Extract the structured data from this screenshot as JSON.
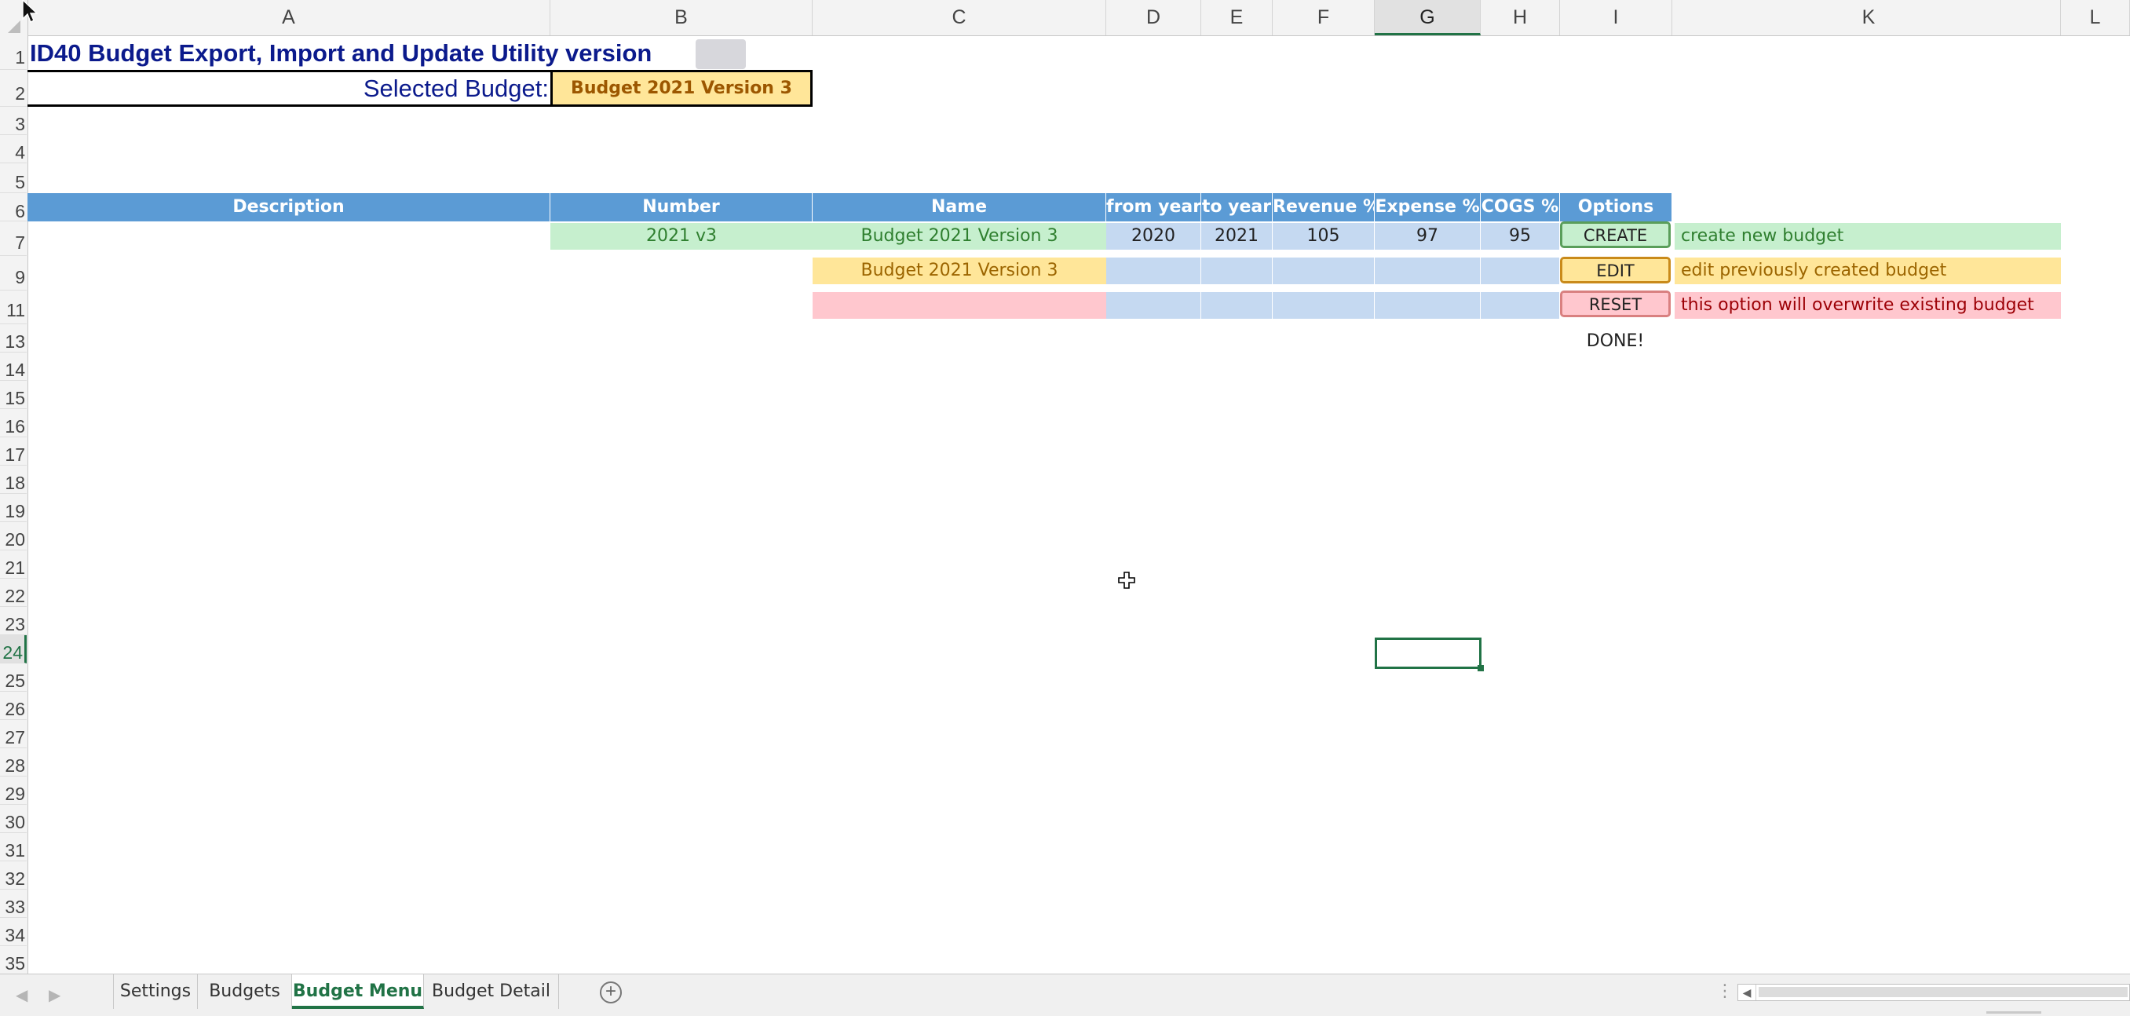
{
  "columns": [
    "A",
    "B",
    "C",
    "D",
    "E",
    "F",
    "G",
    "H",
    "I",
    "K",
    "L"
  ],
  "rows": [
    "1",
    "2",
    "3",
    "4",
    "5",
    "6",
    "7",
    "9",
    "11",
    "13",
    "14",
    "15",
    "16",
    "17",
    "18",
    "19",
    "20",
    "21",
    "22",
    "23",
    "24",
    "25",
    "26",
    "27",
    "28",
    "29",
    "30",
    "31",
    "32",
    "33",
    "34",
    "35"
  ],
  "sheet": {
    "title": "ID40 Budget Export, Import and Update Utility version",
    "selected_label": "Selected Budget:",
    "selected_value": "Budget 2021 Version 3",
    "headers": {
      "description": "Description",
      "number": "Number",
      "name": "Name",
      "from_year": "from year",
      "to_year": "to year",
      "revenue": "Revenue %",
      "expense": "Expense %",
      "cogs": "COGS %",
      "options": "Options"
    },
    "row7": {
      "number": "2021 v3",
      "name": "Budget 2021 Version 3",
      "from_year": "2020",
      "to_year": "2021",
      "revenue": "105",
      "expense": "97",
      "cogs": "95",
      "button": "CREATE",
      "note": "create new budget"
    },
    "row9": {
      "name": "Budget 2021 Version 3",
      "button": "EDIT",
      "note": "edit previously created budget"
    },
    "row11": {
      "button": "RESET",
      "note": "this option will overwrite existing budget"
    },
    "done": "DONE!"
  },
  "tabs": [
    "Settings",
    "Budgets",
    "Budget Menu",
    "Budget Detail"
  ],
  "active_tab": "Budget Menu",
  "colors": {
    "header_blue": "#5b9bd5",
    "green_fill": "#c6efce",
    "yellow_fill": "#ffe699",
    "pink_fill": "#ffc7ce",
    "excel_green": "#217346"
  },
  "icons": {
    "add_sheet": "plus-circle-icon",
    "cursor": "cross-cursor-icon",
    "pointer": "mouse-pointer-icon"
  }
}
